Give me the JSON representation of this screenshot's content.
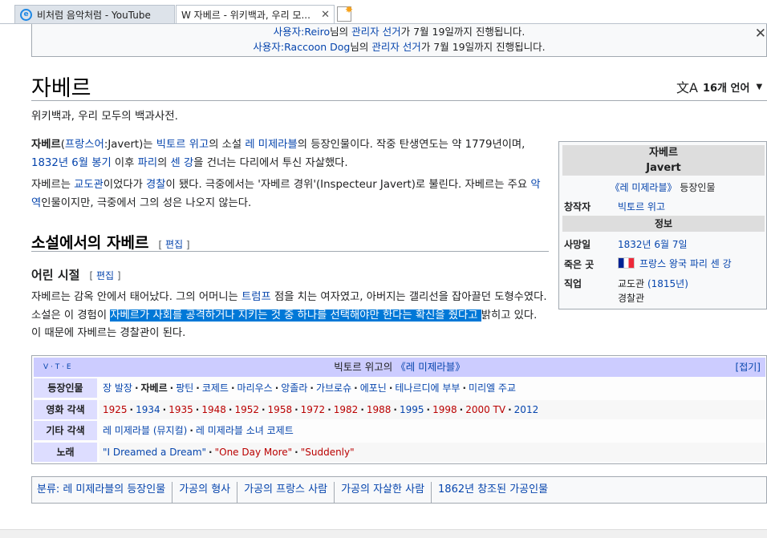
{
  "tabs": [
    {
      "label": "비처럼 음악처럼 - YouTube",
      "icon": "internet-explorer-icon"
    },
    {
      "label": "W 자베르 - 위키백과, 우리 모...",
      "icon": "wikipedia-icon",
      "close": "✕"
    }
  ],
  "notice": {
    "line1_user_prefix": "사용자:",
    "line1_user": "Reiro",
    "line1_mid": "님의 ",
    "line1_link": "관리자 선거",
    "line1_suffix": "가 7월 19일까지 진행됩니다.",
    "line2_user_prefix": "사용자:",
    "line2_user": "Raccoon Dog",
    "line2_mid": "님의 ",
    "line2_link": "관리자 선거",
    "line2_suffix": "가 7월 19일까지 진행됩니다.",
    "close": "✕"
  },
  "page": {
    "title": "자베르",
    "languages": "16개 언어",
    "tagline": "위키백과, 우리 모두의 백과사전."
  },
  "p1": {
    "bold": "자베르",
    "t1": "(",
    "l1": "프랑스어",
    "t2": ":Javert)는 ",
    "l2": "빅토르 위고",
    "t3": "의 소설 ",
    "l3": "레 미제라블",
    "t4": "의 등장인물이다. 작중 탄생연도는 약 1779년이며, ",
    "l4": "1832년 6월 봉기",
    "t5": " 이후 ",
    "l5": "파리",
    "t6": "의 ",
    "l6": "센 강",
    "t7": "을 건너는 다리에서 투신 자살했다."
  },
  "p2": {
    "t1": "자베르는 ",
    "l1": "교도관",
    "t2": "이었다가 ",
    "l2": "경찰",
    "t3": "이 됐다. 극중에서는 '자베르 경위'(Inspecteur Javert)로 불린다. 자베르는 주요 ",
    "l3": "악역",
    "t4": "인물이지만, 극중에서 그의 성은 나오지 않는다."
  },
  "section": {
    "h2": "소설에서의 자베르",
    "h3": "어린 시절",
    "edit_open": "[ ",
    "edit": "편집",
    "edit_close": " ]"
  },
  "p3": {
    "t1": "자베르는 감옥 안에서 태어났다. 그의 어머니는 ",
    "l1": "트럼프",
    "t2": " 점을 치는 여자였고, 아버지는 갤리선을 잡아끌던 도형수였다. 소설은 이 경험이 ",
    "hl": "자베르가 사회를 공격하거나 지키는 것 중 하나를 선택해야만 한다는 확신을 줬다고 ",
    "t3": "밝히고 있다. 이 때문에 자베르는 경찰관이 된다."
  },
  "infobox": {
    "title": "자베르",
    "title_en": "Javert",
    "sub_link": "《레 미제라블》",
    "sub_text": " 등장인물",
    "creator_label": "창작자",
    "creator": "빅토르 위고",
    "section": "정보",
    "death_label": "사망일",
    "death": "1832년 6월 7일",
    "place_label": "죽은 곳",
    "place": "프랑스 왕국 파리 센 강",
    "job_label": "직업",
    "job1": "교도관",
    "job1_year": " (1815년)",
    "job2": "경찰관"
  },
  "navbox": {
    "vte": "V · T · E",
    "title_pre": "빅토르 위고의 ",
    "title_link": "《레 미제라블》",
    "collapse": "[접기]",
    "rows": [
      {
        "label": "등장인물",
        "items": [
          "장 발장",
          "자베르",
          "팡틴",
          "코제트",
          "마리우스",
          "앙졸라",
          "가브로슈",
          "에포닌",
          "테나르디에 부부",
          "미리엘 주교"
        ]
      },
      {
        "label": "영화 각색",
        "items": [
          "1925",
          "1934",
          "1935",
          "1948",
          "1952",
          "1958",
          "1972",
          "1982",
          "1988",
          "1995",
          "1998",
          "2000 TV",
          "2012"
        ]
      },
      {
        "label": "기타 각색",
        "items": [
          "레 미제라블 (뮤지컬)",
          "레 미제라블 소녀 코제트"
        ]
      },
      {
        "label": "노래",
        "items": [
          "\"I Dreamed a Dream\"",
          "\"One Day More\"",
          "\"Suddenly\""
        ]
      }
    ]
  },
  "categories": {
    "label": "분류:",
    "items": [
      "레 미제라블의 등장인물",
      "가공의 형사",
      "가공의 프랑스 사람",
      "가공의 자살한 사람",
      "1862년 창조된 가공인물"
    ]
  }
}
